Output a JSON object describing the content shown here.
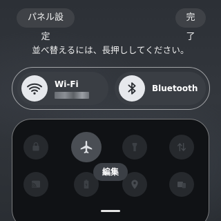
{
  "header": {
    "panel_settings_label": "パネル設定",
    "done_label": "完了"
  },
  "instruction": "並べ替えるには、長押ししてください。",
  "tiles": {
    "wifi": {
      "label": "Wi-Fi",
      "icon": "wifi-icon"
    },
    "bluetooth": {
      "label": "Bluetooth",
      "icon": "bluetooth-icon"
    }
  },
  "grid_icons": [
    "lock-rotate-icon",
    "airplane-icon",
    "flashlight-icon",
    "data-transfer-icon",
    "cast-icon",
    "battery-saver-icon",
    "location-icon",
    "device-control-icon"
  ],
  "edit_label": "編集",
  "colors": {
    "background": "#2f3338",
    "tile": "#3a3e44",
    "icon_circle": "#e6e8ec",
    "panel": "#101215"
  }
}
